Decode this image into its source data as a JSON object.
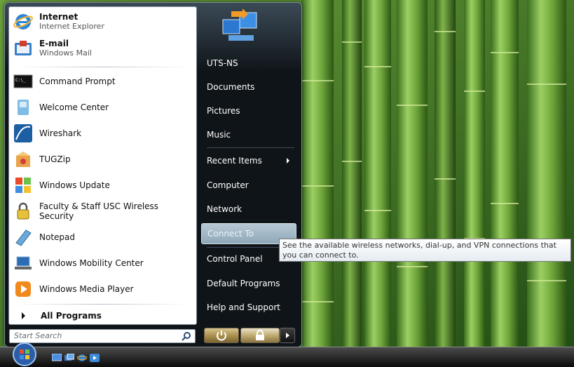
{
  "start_menu": {
    "programs": [
      {
        "name": "Internet",
        "subtitle": "Internet Explorer",
        "icon": "internet-explorer-icon"
      },
      {
        "name": "E-mail",
        "subtitle": "Windows Mail",
        "icon": "windows-mail-icon"
      },
      {
        "name": "Command Prompt",
        "icon": "command-prompt-icon"
      },
      {
        "name": "Welcome Center",
        "icon": "welcome-center-icon"
      },
      {
        "name": "Wireshark",
        "icon": "wireshark-icon"
      },
      {
        "name": "TUGZip",
        "icon": "tugzip-icon"
      },
      {
        "name": "Windows Update",
        "icon": "windows-update-icon"
      },
      {
        "name": "Faculty & Staff USC Wireless Security",
        "icon": "lock-icon"
      },
      {
        "name": "Notepad",
        "icon": "notepad-icon"
      },
      {
        "name": "Windows Mobility Center",
        "icon": "mobility-center-icon"
      },
      {
        "name": "Windows Media Player",
        "icon": "media-player-icon"
      }
    ],
    "all_programs": "All Programs",
    "search_placeholder": "Start Search",
    "right_items": [
      {
        "label": "UTS-NS"
      },
      {
        "label": "Documents"
      },
      {
        "label": "Pictures"
      },
      {
        "label": "Music"
      },
      {
        "label": "Recent Items",
        "submenu": true
      },
      {
        "label": "Computer"
      },
      {
        "label": "Network"
      },
      {
        "label": "Connect To",
        "highlighted": true
      },
      {
        "label": "Control Panel"
      },
      {
        "label": "Default Programs"
      },
      {
        "label": "Help and Support"
      }
    ]
  },
  "tooltip": {
    "text": "See the available wireless networks, dial-up, and VPN connections that you can connect to."
  },
  "colors": {
    "desktop_green": "#3f7a22",
    "menu_dark": "#0f1418",
    "highlight": "#a3bac9",
    "power_gold": "#bda66a"
  }
}
